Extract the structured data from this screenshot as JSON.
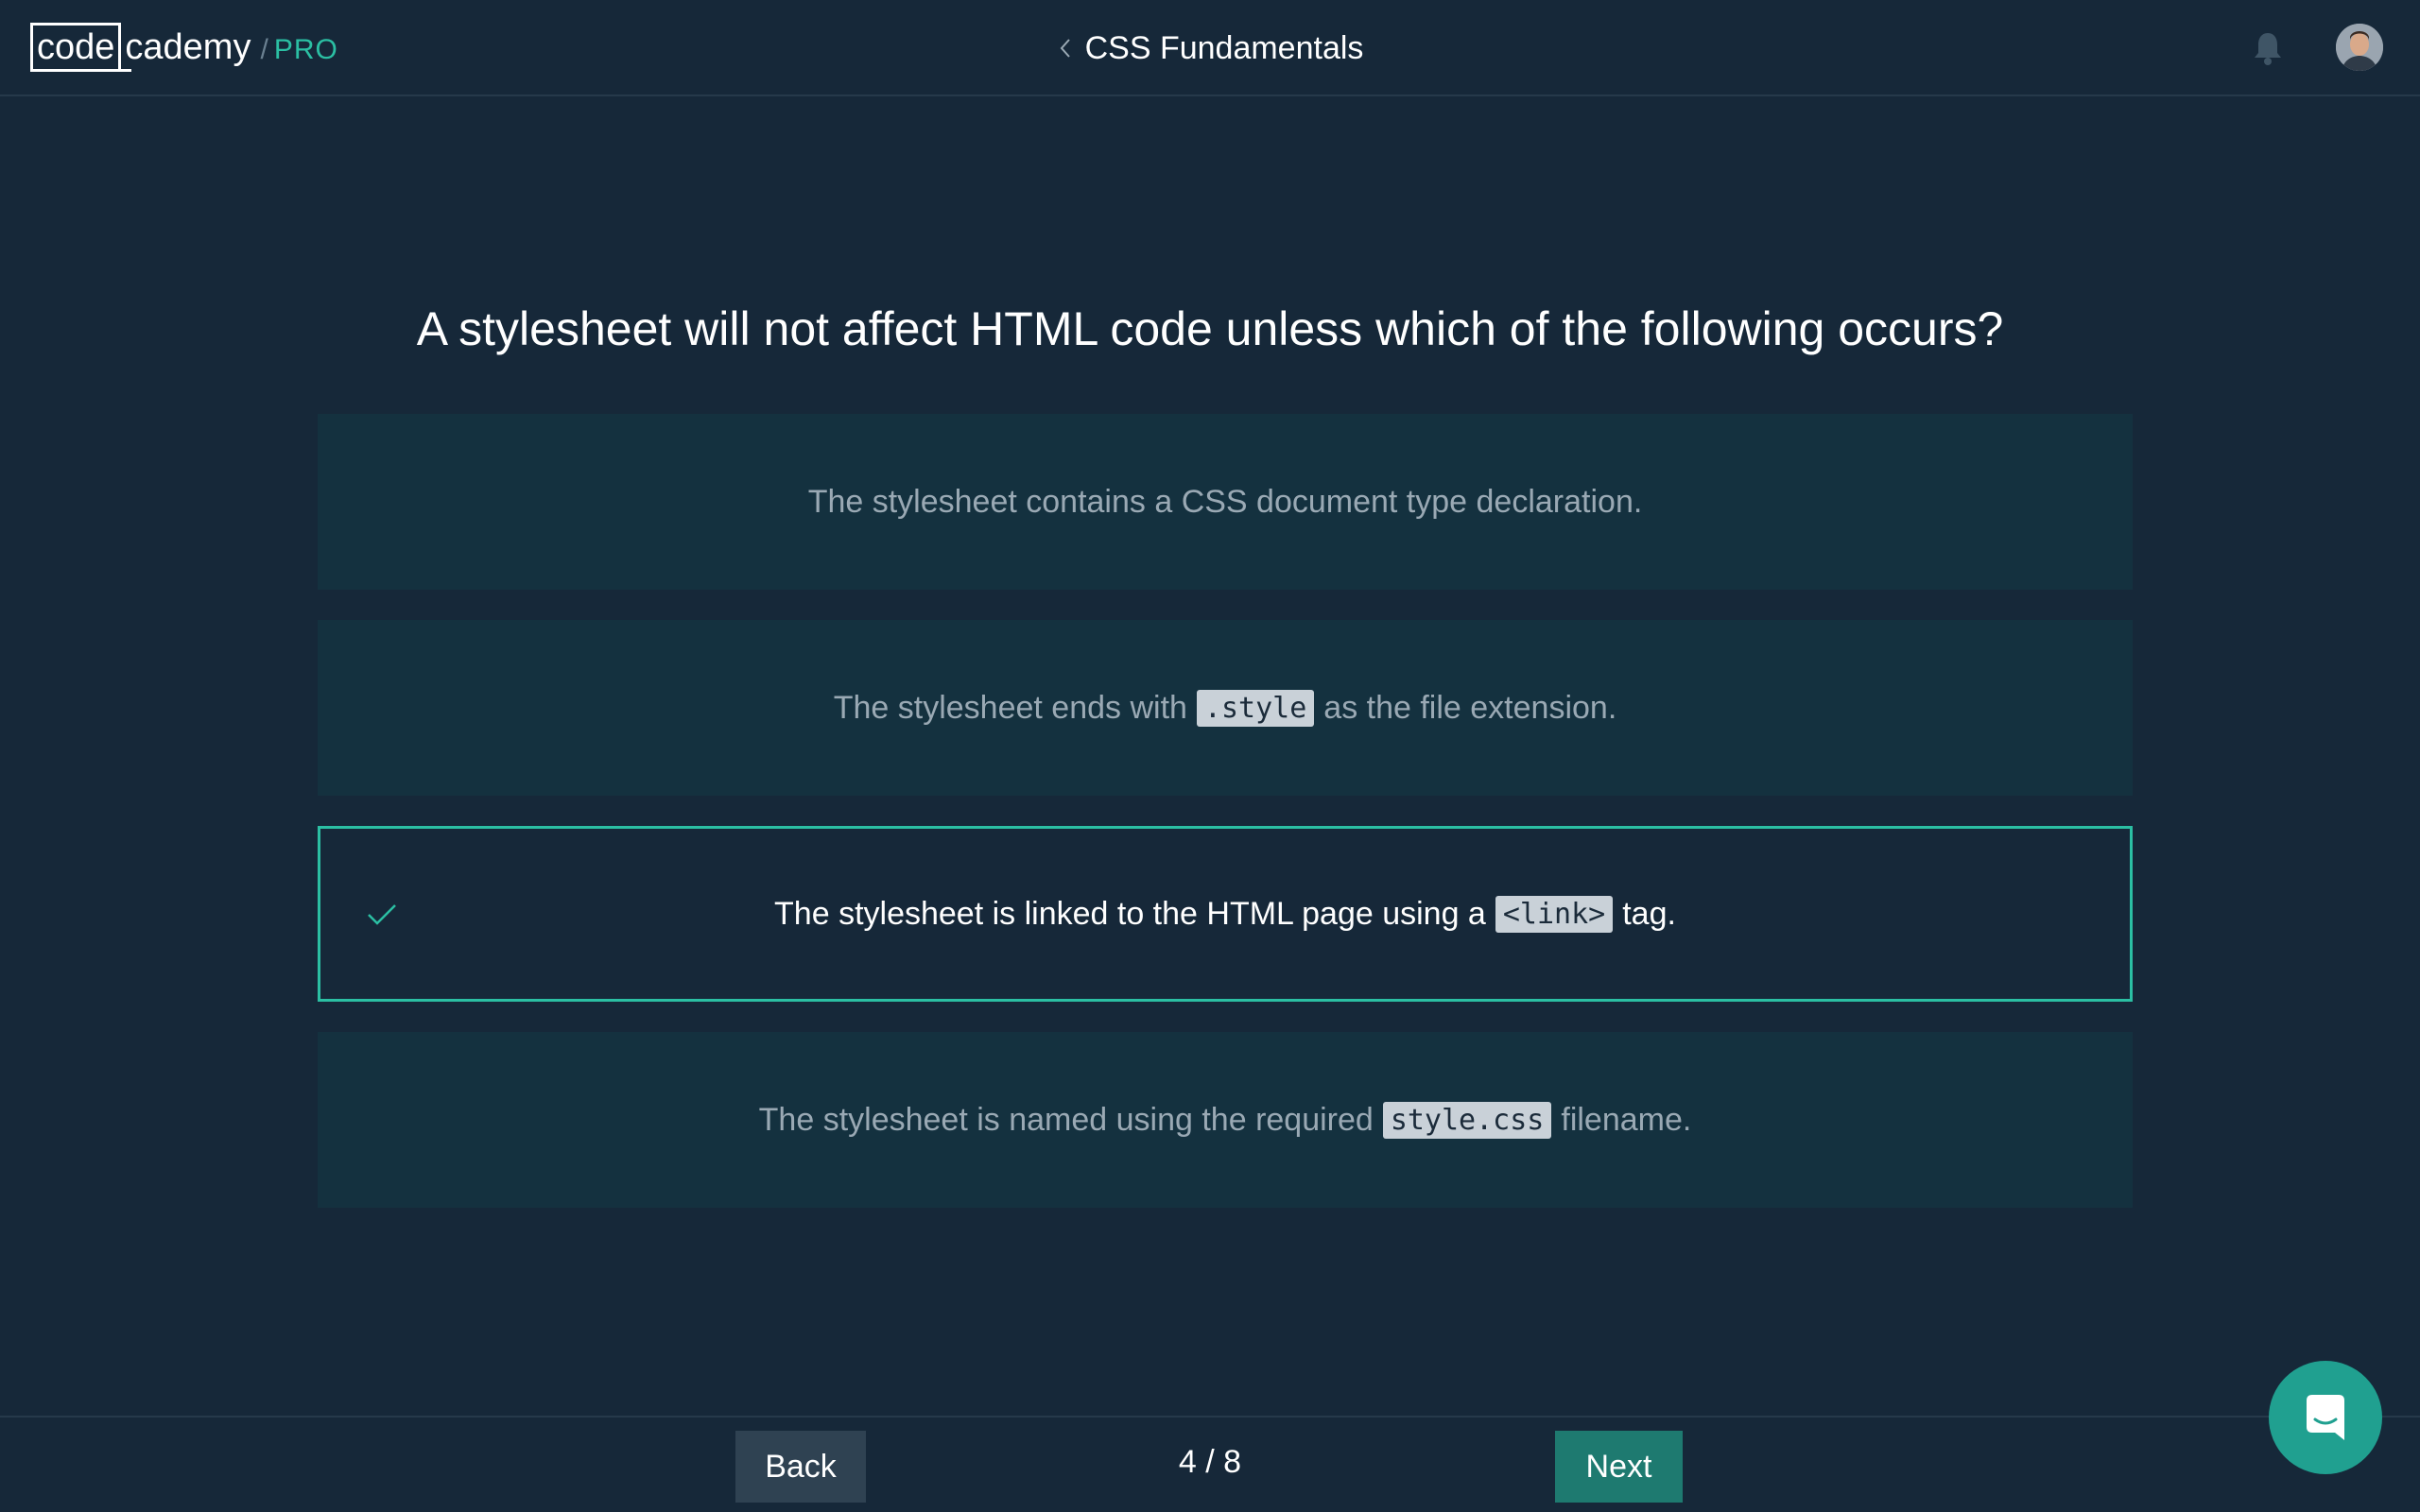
{
  "header": {
    "logo_code": "code",
    "logo_cademy": "cademy",
    "logo_slash": "/",
    "logo_pro": "PRO",
    "course_title": "CSS Fundamentals",
    "icons": {
      "back": "chevron-left-icon",
      "notifications": "bell-icon",
      "profile": "avatar"
    }
  },
  "quiz": {
    "question": "A stylesheet will not affect HTML code unless which of the following occurs?",
    "answers": [
      {
        "before": "The stylesheet contains a CSS document type declaration.",
        "code": "",
        "after": "",
        "selected": false
      },
      {
        "before": "The stylesheet ends with",
        "code": ".style",
        "after": "as the file extension.",
        "selected": false
      },
      {
        "before": "The stylesheet is linked to the HTML page using a",
        "code": "<link>",
        "after": "tag.",
        "selected": true
      },
      {
        "before": "The stylesheet is named using the required",
        "code": "style.css",
        "after": "filename.",
        "selected": false
      }
    ]
  },
  "footer": {
    "back_label": "Back",
    "progress": "4 / 8",
    "next_label": "Next"
  },
  "colors": {
    "background": "#162839",
    "answer_background": "#14313f",
    "accent": "#2bbfa3",
    "next_button": "#1e7a70",
    "back_button": "#2f4252"
  }
}
